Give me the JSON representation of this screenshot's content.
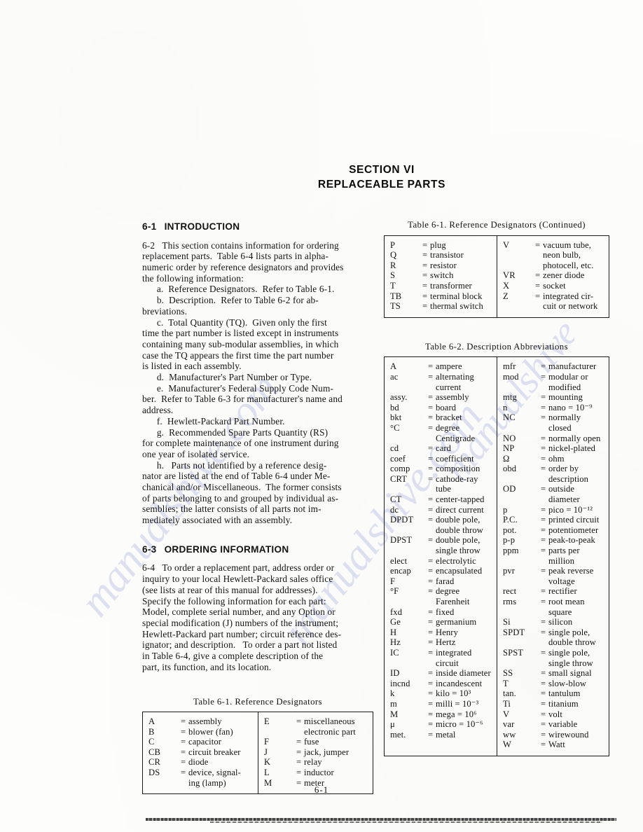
{
  "document": {
    "section_title_line1": "SECTION VI",
    "section_title_line2": "REPLACEABLE PARTS",
    "page_number": "6-1",
    "watermark": "manualshive.com"
  },
  "left_column": {
    "heading_6_1": {
      "number": "6-1",
      "title": "INTRODUCTION"
    },
    "para_6_2": "6-2   This section contains information for ordering\nreplacement parts.  Table 6-4 lists parts in alpha-\nnumeric order by reference designators and provides\nthe following information:\n      a.  Reference Designators.  Refer to Table 6-1.\n      b.  Description.  Refer to Table 6-2 for ab-\nbreviations.\n      c.  Total Quantity (TQ).  Given only the first\ntime the part number is listed except in instruments\ncontaining many sub-modular assemblies, in which\ncase the TQ appears the first time the part number\nis listed in each assembly.\n      d.  Manufacturer's Part Number or Type.\n      e.  Manufacturer's Federal Supply Code Num-\nber.  Refer to Table 6-3 for manufacturer's name and\naddress.\n      f.  Hewlett-Packard Part Number.\n      g.  Recommended Spare Parts Quantity (RS)\nfor complete maintenance of one instrument during\none year of isolated service.\n      h.   Parts not identified by a reference desig-\nnator are listed at the end of Table 6-4 under Me-\nchanical and/or Miscellaneous.  The former consists\nof parts belonging to and grouped by individual as-\nsemblies; the latter consists of all parts not im-\nmediately associated with an assembly.",
    "heading_6_3": {
      "number": "6-3",
      "title": "ORDERING INFORMATION"
    },
    "para_6_4": "6-4   To order a replacement part, address order or\ninquiry to your local Hewlett-Packard sales office\n(see lists at rear of this manual for addresses).\nSpecify the following information for each part:\nModel, complete serial number, and any Option or\nspecial modification (J) numbers of the instrument;\nHewlett-Packard part number; circuit reference des-\nignator; and description.   To order a part not listed\nin Table 6-4, give a complete description of the\npart, its function, and its location."
  },
  "table_6_1_bottom_left": {
    "caption": "Table 6-1.  Reference Designators",
    "left_entries": [
      {
        "sym": "A",
        "def": "assembly"
      },
      {
        "sym": "B",
        "def": "blower (fan)"
      },
      {
        "sym": "C",
        "def": "capacitor"
      },
      {
        "sym": "CB",
        "def": "circuit breaker"
      },
      {
        "sym": "CR",
        "def": "diode"
      },
      {
        "sym": "DS",
        "def": "device, signal-\ning (lamp)"
      }
    ],
    "right_entries": [
      {
        "sym": "E",
        "def": "miscellaneous\nelectronic part"
      },
      {
        "sym": "F",
        "def": "fuse"
      },
      {
        "sym": "J",
        "def": "jack, jumper"
      },
      {
        "sym": "K",
        "def": "relay"
      },
      {
        "sym": "L",
        "def": "inductor"
      },
      {
        "sym": "M",
        "def": "meter"
      }
    ]
  },
  "table_6_1_continued": {
    "caption": "Table 6-1.  Reference Designators (Continued)",
    "left_entries": [
      {
        "sym": "P",
        "def": "plug"
      },
      {
        "sym": "Q",
        "def": "transistor"
      },
      {
        "sym": "R",
        "def": "resistor"
      },
      {
        "sym": "S",
        "def": "switch"
      },
      {
        "sym": "T",
        "def": "transformer"
      },
      {
        "sym": "TB",
        "def": "terminal block"
      },
      {
        "sym": "TS",
        "def": "thermal switch"
      }
    ],
    "right_entries": [
      {
        "sym": "V",
        "def": "vacuum tube,\nneon bulb,\nphotocell, etc."
      },
      {
        "sym": "VR",
        "def": "zener diode"
      },
      {
        "sym": "X",
        "def": "socket"
      },
      {
        "sym": "Z",
        "def": "integrated cir-\ncuit or network"
      }
    ]
  },
  "table_6_2": {
    "caption": "Table 6-2.  Description Abbreviations",
    "left_entries": [
      {
        "sym": "A",
        "def": "ampere"
      },
      {
        "sym": "ac",
        "def": "alternating\ncurrent"
      },
      {
        "sym": "assy.",
        "def": "assembly"
      },
      {
        "sym": "bd",
        "def": "board"
      },
      {
        "sym": "bkt",
        "def": "bracket"
      },
      {
        "sym": "°C",
        "def": "degree\nCentigrade"
      },
      {
        "sym": "cd",
        "def": "card"
      },
      {
        "sym": "coef",
        "def": "coefficient"
      },
      {
        "sym": "comp",
        "def": "composition"
      },
      {
        "sym": "CRT",
        "def": "cathode-ray\ntube"
      },
      {
        "sym": "CT",
        "def": "center-tapped"
      },
      {
        "sym": "dc",
        "def": "direct current"
      },
      {
        "sym": "DPDT",
        "def": "double pole,\ndouble throw"
      },
      {
        "sym": "DPST",
        "def": "double pole,\nsingle throw"
      },
      {
        "sym": "elect",
        "def": "electrolytic"
      },
      {
        "sym": "encap",
        "def": "encapsulated"
      },
      {
        "sym": "F",
        "def": "farad"
      },
      {
        "sym": "°F",
        "def": "degree\nFarenheit"
      },
      {
        "sym": "fxd",
        "def": "fixed"
      },
      {
        "sym": "Ge",
        "def": "germanium"
      },
      {
        "sym": "H",
        "def": "Henry"
      },
      {
        "sym": "Hz",
        "def": "Hertz"
      },
      {
        "sym": "IC",
        "def": "integrated\ncircuit"
      },
      {
        "sym": "ID",
        "def": "inside diameter"
      },
      {
        "sym": "incnd",
        "def": "incandescent"
      },
      {
        "sym": "k",
        "def": "kilo = 10³"
      },
      {
        "sym": "m",
        "def": "milli = 10⁻³"
      },
      {
        "sym": "M",
        "def": "mega = 10⁶"
      },
      {
        "sym": "μ",
        "def": "micro = 10⁻⁶"
      },
      {
        "sym": "met.",
        "def": "metal"
      }
    ],
    "right_entries": [
      {
        "sym": "mfr",
        "def": "manufacturer"
      },
      {
        "sym": "mod",
        "def": "modular or\nmodified"
      },
      {
        "sym": "mtg",
        "def": "mounting"
      },
      {
        "sym": "n",
        "def": "nano = 10⁻⁹"
      },
      {
        "sym": "NC",
        "def": "normally closed"
      },
      {
        "sym": "NO",
        "def": "normally open"
      },
      {
        "sym": "NP",
        "def": "nickel-plated"
      },
      {
        "sym": "Ω",
        "def": "ohm"
      },
      {
        "sym": "obd",
        "def": "order by\ndescription"
      },
      {
        "sym": "OD",
        "def": "outside\ndiameter"
      },
      {
        "sym": "p",
        "def": "pico = 10⁻¹²"
      },
      {
        "sym": "P.C.",
        "def": "printed circuit"
      },
      {
        "sym": "pot.",
        "def": "potentiometer"
      },
      {
        "sym": "p-p",
        "def": "peak-to-peak"
      },
      {
        "sym": "ppm",
        "def": "parts per\nmillion"
      },
      {
        "sym": "pvr",
        "def": "peak reverse\nvoltage"
      },
      {
        "sym": "rect",
        "def": "rectifier"
      },
      {
        "sym": "rms",
        "def": "root mean\nsquare"
      },
      {
        "sym": "Si",
        "def": "silicon"
      },
      {
        "sym": "SPDT",
        "def": "single pole,\ndouble throw"
      },
      {
        "sym": "SPST",
        "def": "single pole,\nsingle throw"
      },
      {
        "sym": "SS",
        "def": "small signal"
      },
      {
        "sym": "T",
        "def": "slow-blow"
      },
      {
        "sym": "tan.",
        "def": "tantulum"
      },
      {
        "sym": "Ti",
        "def": "titanium"
      },
      {
        "sym": "V",
        "def": "volt"
      },
      {
        "sym": "var",
        "def": "variable"
      },
      {
        "sym": "ww",
        "def": "wirewound"
      },
      {
        "sym": "W",
        "def": "Watt"
      }
    ]
  }
}
